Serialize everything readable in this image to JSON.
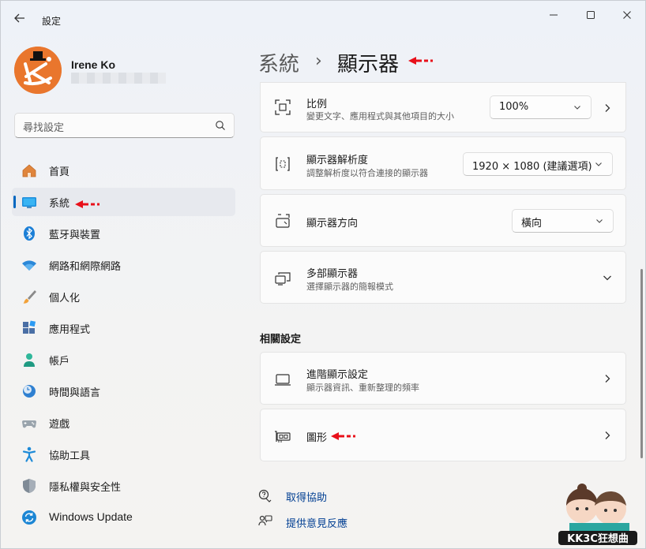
{
  "app": {
    "title": "設定"
  },
  "user": {
    "name": "Irene Ko"
  },
  "search": {
    "placeholder": "尋找設定"
  },
  "sidebar": {
    "items": [
      {
        "label": "首頁",
        "icon": "home-icon"
      },
      {
        "label": "系統",
        "icon": "system-icon",
        "active": true
      },
      {
        "label": "藍牙與裝置",
        "icon": "bluetooth-icon"
      },
      {
        "label": "網路和網際網路",
        "icon": "wifi-icon"
      },
      {
        "label": "個人化",
        "icon": "brush-icon"
      },
      {
        "label": "應用程式",
        "icon": "apps-icon"
      },
      {
        "label": "帳戶",
        "icon": "account-icon"
      },
      {
        "label": "時間與語言",
        "icon": "clock-globe-icon"
      },
      {
        "label": "遊戲",
        "icon": "gamepad-icon"
      },
      {
        "label": "協助工具",
        "icon": "accessibility-icon"
      },
      {
        "label": "隱私權與安全性",
        "icon": "shield-icon"
      },
      {
        "label": "Windows Update",
        "icon": "update-icon"
      }
    ]
  },
  "header": {
    "parent": "系統",
    "separator": "›",
    "current": "顯示器"
  },
  "settings": {
    "scale": {
      "title": "比例",
      "desc": "變更文字、應用程式與其他項目的大小",
      "value": "100%"
    },
    "resolution": {
      "title": "顯示器解析度",
      "desc": "調整解析度以符合連接的顯示器",
      "value": "1920 × 1080 (建議選項)"
    },
    "orientation": {
      "title": "顯示器方向",
      "value": "橫向"
    },
    "multiple": {
      "title": "多部顯示器",
      "desc": "選擇顯示器的簡報模式"
    }
  },
  "related": {
    "heading": "相關設定",
    "advanced": {
      "title": "進階顯示設定",
      "desc": "顯示器資訊、重新整理的頻率"
    },
    "graphics": {
      "title": "圖形"
    }
  },
  "links": {
    "help": "取得協助",
    "feedback": "提供意見反應"
  },
  "watermark": {
    "text": "KK3C狂想曲"
  },
  "colors": {
    "accent": "#0067c0",
    "annotation": "#e8101a",
    "avatar": "#e9762d"
  }
}
